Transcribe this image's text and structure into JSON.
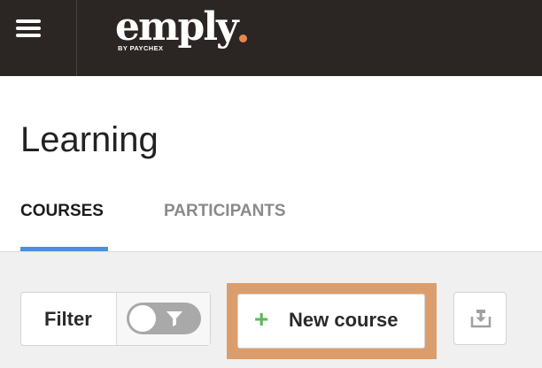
{
  "topbar": {
    "menu_icon": "hamburger-menu-icon",
    "logo": {
      "word": "emply",
      "sub": "BY PAYCHEX",
      "dot_color": "#e48a4e"
    },
    "background": "#2b2624"
  },
  "page": {
    "title": "Learning"
  },
  "tabs": [
    {
      "label": "COURSES",
      "active": true
    },
    {
      "label": "PARTICIPANTS",
      "active": false
    }
  ],
  "toolbar": {
    "filter_label": "Filter",
    "filter_toggle_on": false,
    "filter_icon": "funnel-icon",
    "new_course_label": "New course",
    "new_course_icon": "plus-icon",
    "export_icon": "download-tray-icon",
    "highlight_color": "#dc9d6d",
    "accent_color": "#4a90e2",
    "plus_color": "#5cb85c"
  }
}
